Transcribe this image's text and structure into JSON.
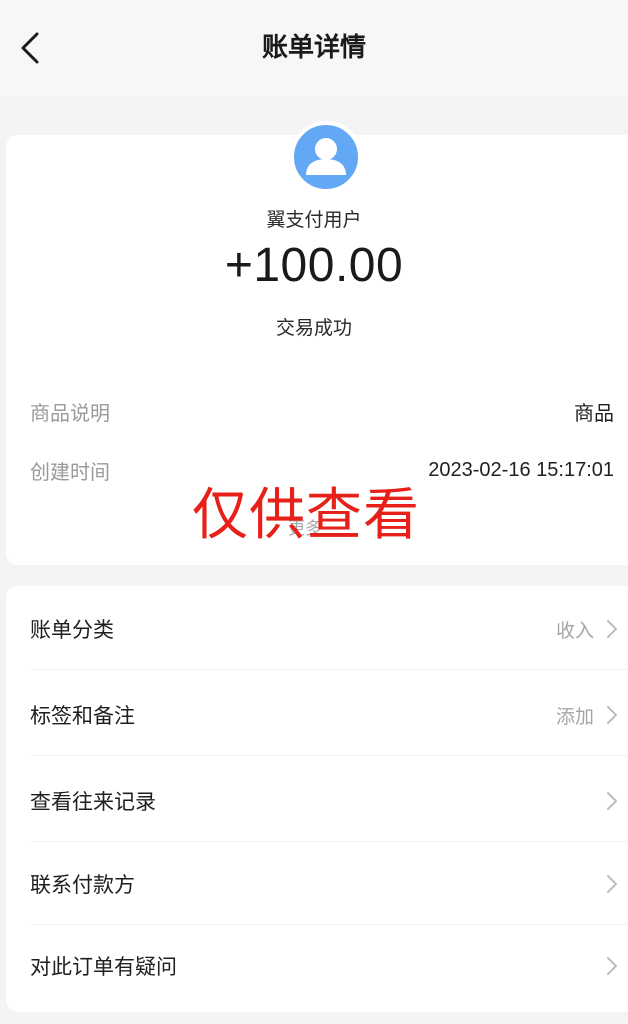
{
  "header": {
    "title": "账单详情"
  },
  "summary": {
    "payer_name": "翼支付用户",
    "amount": "+100.00",
    "status": "交易成功",
    "details": [
      {
        "label": "商品说明",
        "value": "商品"
      },
      {
        "label": "创建时间",
        "value": "2023-02-16 15:17:01"
      }
    ],
    "more_label": "更多",
    "watermark": "仅供查看"
  },
  "actions": [
    {
      "label": "账单分类",
      "value": "收入"
    },
    {
      "label": "标签和备注",
      "value": "添加"
    },
    {
      "label": "查看往来记录",
      "value": ""
    },
    {
      "label": "联系付款方",
      "value": ""
    },
    {
      "label": "对此订单有疑问",
      "value": ""
    }
  ],
  "colors": {
    "accent_avatar": "#63a8f5",
    "watermark": "#e8201a",
    "background": "#f4f4f4",
    "card": "#ffffff"
  },
  "icons": {
    "back": "chevron-left-icon",
    "avatar": "user-icon",
    "row": "chevron-right-icon"
  }
}
